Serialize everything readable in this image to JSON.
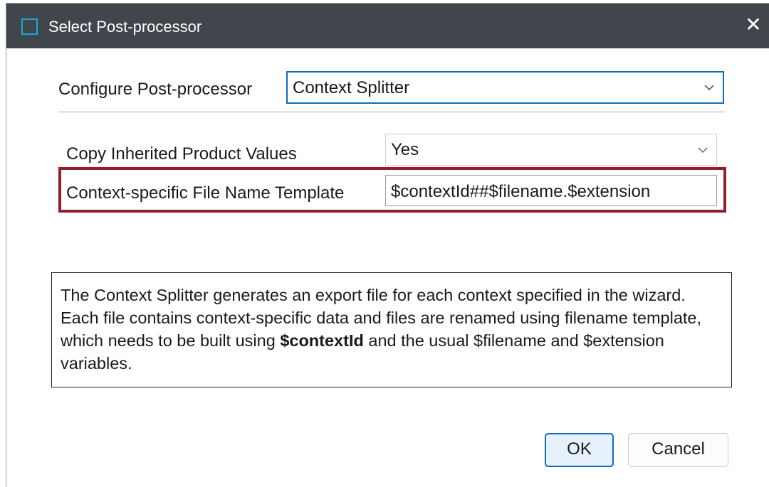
{
  "window": {
    "title": "Select Post-processor",
    "close_glyph": "✕"
  },
  "configure": {
    "label": "Configure Post-processor",
    "selected": "Context Splitter"
  },
  "options": {
    "copy_inherited": {
      "label": "Copy Inherited Product Values",
      "selected": "Yes"
    },
    "filename_template": {
      "label": "Context-specific File Name Template",
      "value": "$contextId##$filename.$extension"
    }
  },
  "info": {
    "text_before": "The Context Splitter generates an export file for each context specified in the wizard. Each file contains context-specific data and files are renamed using filename template, which needs to be built using ",
    "bold": "$contextId",
    "text_after": " and the usual $filename and $extension variables."
  },
  "buttons": {
    "ok": "OK",
    "cancel": "Cancel"
  },
  "colors": {
    "titlebar": "#40464b",
    "highlight": "#8f1f2b",
    "accent": "#0f6cbd"
  }
}
